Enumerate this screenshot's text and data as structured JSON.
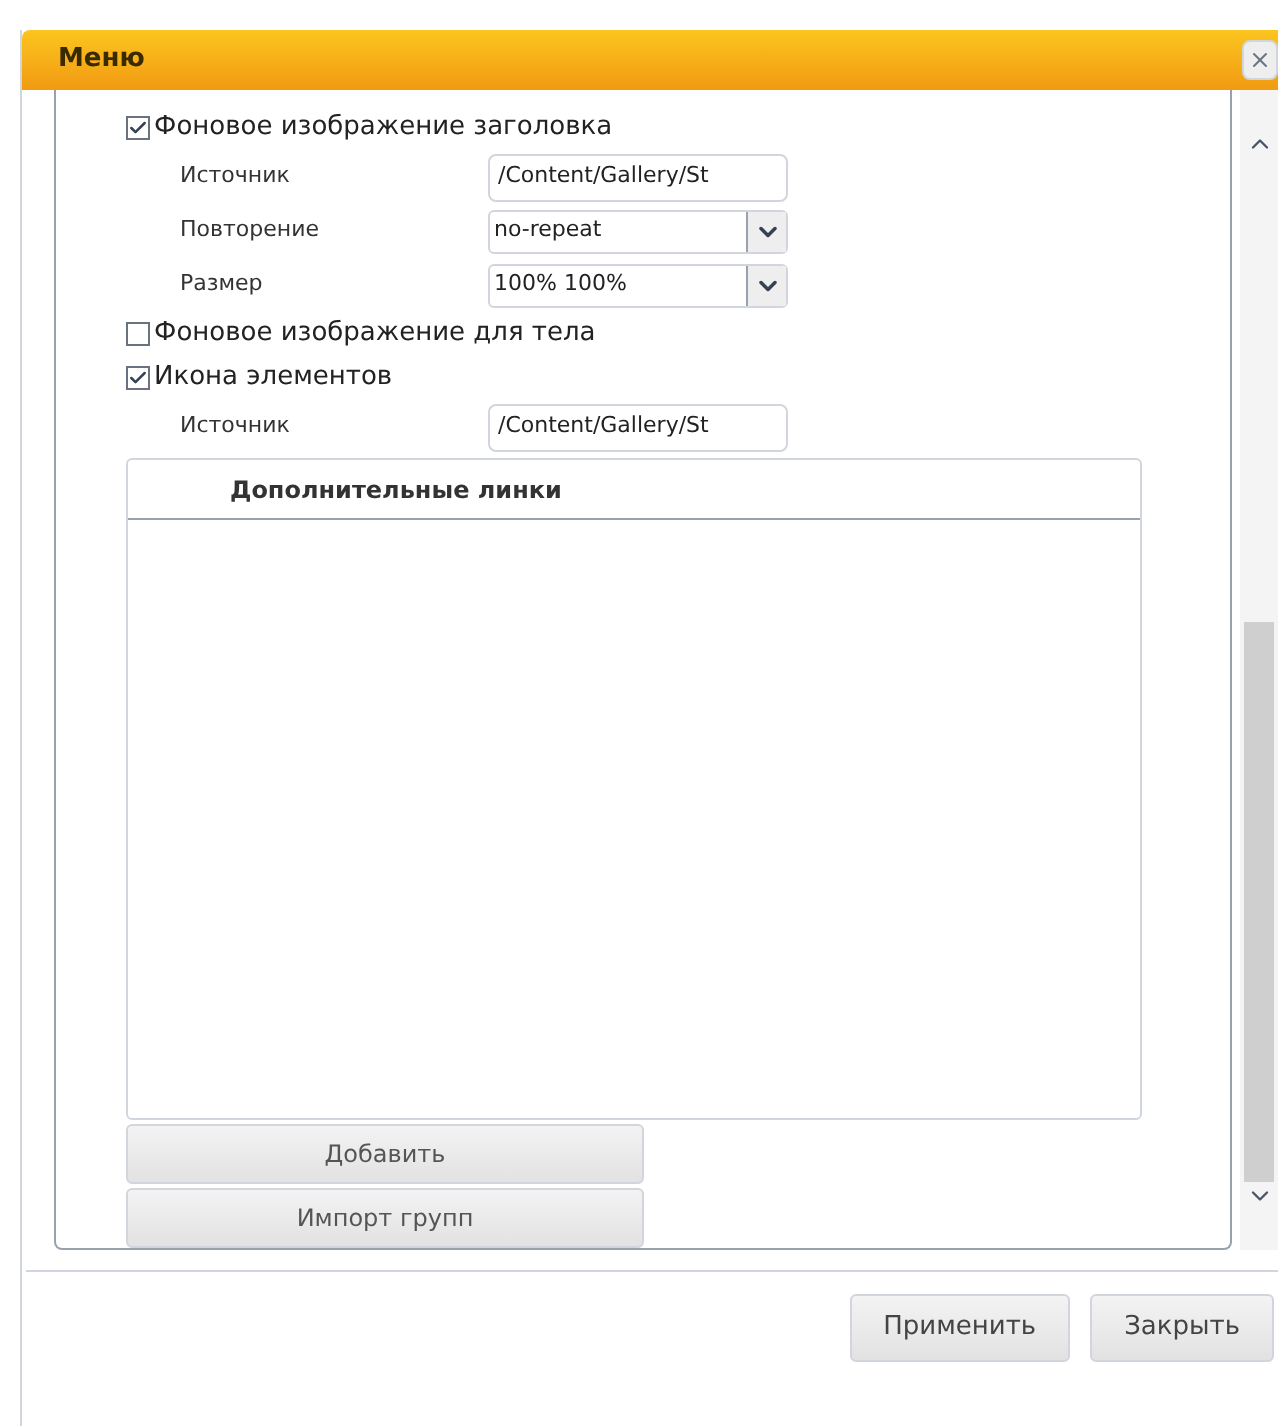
{
  "window": {
    "title": "Меню"
  },
  "options": [
    {
      "label": "Фоновое изображение заголовка",
      "checked": true,
      "fields": [
        {
          "kind": "text",
          "label": "Источник",
          "value": "/Content/Gallery/St"
        },
        {
          "kind": "select",
          "label": "Повторение",
          "value": "no-repeat"
        },
        {
          "kind": "select",
          "label": "Размер",
          "value": "100% 100%"
        }
      ]
    },
    {
      "label": "Фоновое изображение для тела",
      "checked": false
    },
    {
      "label": "Икона элементов",
      "checked": true,
      "fields": [
        {
          "kind": "text",
          "label": "Источник",
          "value": "/Content/Gallery/St"
        }
      ]
    }
  ],
  "links_table": {
    "columns": [
      "Дополнительные линки"
    ]
  },
  "table_buttons": [
    "Добавить",
    "Импорт групп"
  ],
  "footer_buttons": [
    "Применить",
    "Закрыть"
  ]
}
